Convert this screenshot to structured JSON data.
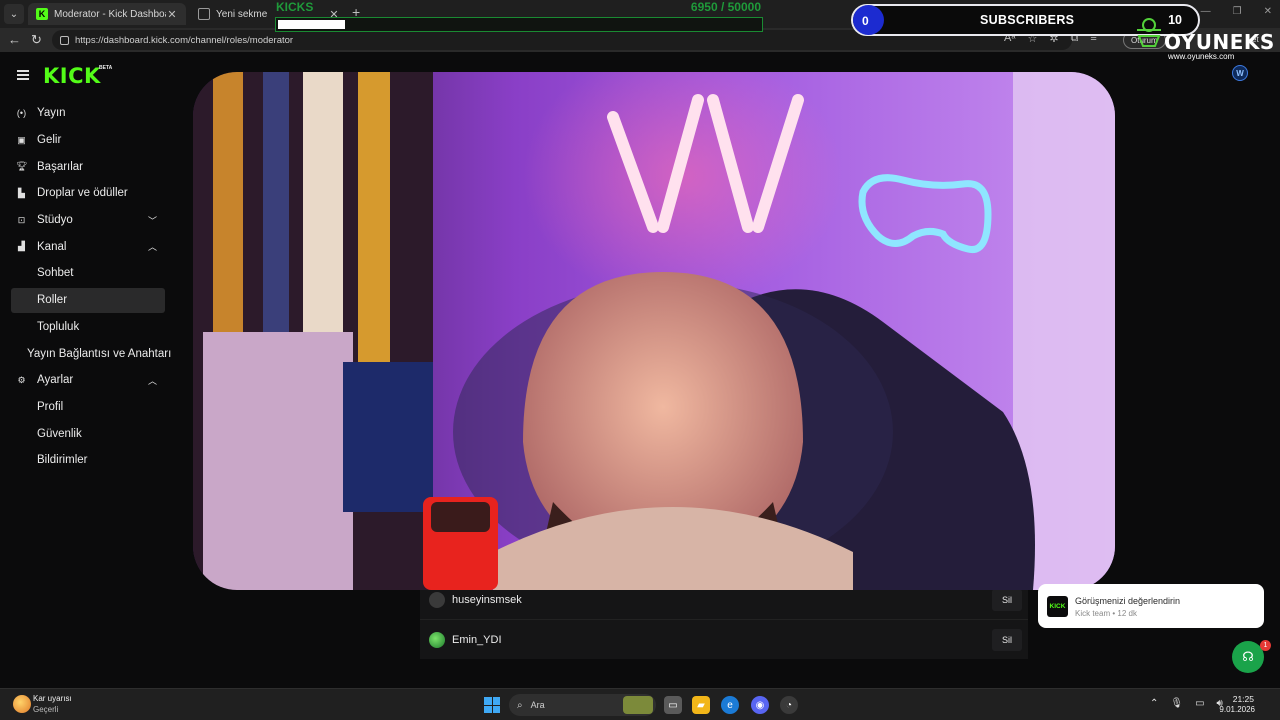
{
  "browser": {
    "tabs": [
      {
        "label": "Moderator - Kick Dashboard",
        "active": true,
        "favicon": "kick-favicon"
      },
      {
        "label": "Yeni sekme",
        "active": false,
        "favicon": "new-tab-favicon"
      }
    ],
    "url": "https://dashboard.kick.com/channel/roles/moderator",
    "signin_label": "Oturum",
    "profile_label": "et"
  },
  "app": {
    "logo": "KICK",
    "logo_badge": "BETA",
    "brand_color": "#53fc18",
    "corner_avatar_letter": "W"
  },
  "sidebar": {
    "items": [
      {
        "label": "Yayın",
        "icon": "broadcast-icon"
      },
      {
        "label": "Gelir",
        "icon": "revenue-icon"
      },
      {
        "label": "Başarılar",
        "icon": "trophy-icon"
      },
      {
        "label": "Droplar ve ödüller",
        "icon": "drops-icon"
      },
      {
        "label": "Stüdyo",
        "icon": "studio-icon",
        "expanded": false
      },
      {
        "label": "Kanal",
        "icon": "channel-icon",
        "expanded": true
      },
      {
        "label": "Sohbet"
      },
      {
        "label": "Roller",
        "selected": true
      },
      {
        "label": "Topluluk"
      },
      {
        "label": "Yayın Bağlantısı ve Anahtarı"
      },
      {
        "label": "Ayarlar",
        "icon": "settings-icon",
        "expanded": true
      },
      {
        "label": "Profil"
      },
      {
        "label": "Güvenlik"
      },
      {
        "label": "Bildirimler"
      }
    ]
  },
  "moderators": [
    {
      "username": "huseyinsmsek",
      "action": "Sil"
    },
    {
      "username": "Emin_YDI",
      "action": "Sil"
    }
  ],
  "overlays": {
    "kicks": {
      "label": "KICKS",
      "current": 6950,
      "goal": 50000,
      "display": "6950 / 50000",
      "progress": 0.139
    },
    "subscribers": {
      "label": "SUBSCRIBERS",
      "current": "0",
      "goal": "10"
    },
    "brand": {
      "name": "OYUNEKS",
      "url": "www.oyuneks.com"
    }
  },
  "toast": {
    "title": "Görüşmenizi değerlendirin",
    "subtitle": "Kick team • 12 dk"
  },
  "support": {
    "badge_count": "1"
  },
  "taskbar": {
    "weather_warning": "Kar uyarısı",
    "weather_status": "Geçerli",
    "search_placeholder": "Ara",
    "time": "21:25",
    "date": "9.01.2026"
  }
}
